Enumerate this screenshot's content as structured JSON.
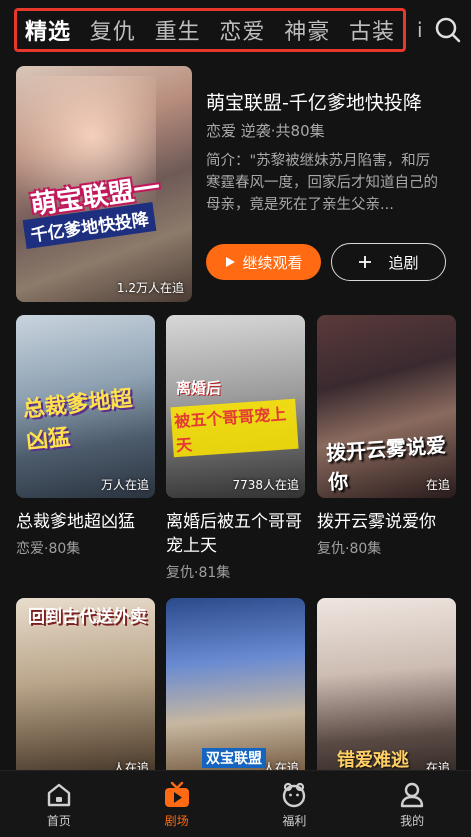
{
  "tabs": [
    {
      "label": "精选",
      "active": true
    },
    {
      "label": "复仇"
    },
    {
      "label": "重生"
    },
    {
      "label": "恋爱"
    },
    {
      "label": "神豪"
    },
    {
      "label": "古装"
    }
  ],
  "more_tab": "i",
  "featured": {
    "poster_title_a": "萌宝联盟一",
    "poster_title_b": "千亿爹地快投降",
    "watch_count": "1.2万人在追",
    "title": "萌宝联盟-千亿爹地快投降",
    "meta": "恋爱 逆袭·共80集",
    "description": "简介：\"苏黎被继妹苏月陷害，和厉寒霆春风一度，回家后才知道自己的母亲，竟是死在了亲生父亲...",
    "continue_label": "继续观看",
    "follow_label": "追剧"
  },
  "cards": [
    {
      "title": "总裁爹地超凶猛",
      "meta": "恋爱·80集",
      "count": "万人在追",
      "poster_text": "总裁爹地超凶猛"
    },
    {
      "title": "离婚后被五个哥哥宠上天",
      "meta": "复仇·81集",
      "count": "7738人在追",
      "poster_text_a": "离婚后",
      "poster_text_b": "被五个哥哥宠上天"
    },
    {
      "title": "拨开云雾说爱你",
      "meta": "复仇·80集",
      "count": "在追",
      "poster_text": "拨开云雾说爱你"
    },
    {
      "title": "",
      "meta": "",
      "count": "人在追",
      "poster_text": "回到古代送外卖"
    },
    {
      "title": "",
      "meta": "",
      "count": "人在追",
      "poster_text": "双宝联盟"
    },
    {
      "title": "",
      "meta": "",
      "count": "在追",
      "poster_text": "错爱难逃"
    }
  ],
  "nav": [
    {
      "label": "首页",
      "icon": "home-icon"
    },
    {
      "label": "剧场",
      "icon": "theater-icon",
      "active": true
    },
    {
      "label": "福利",
      "icon": "gift-icon"
    },
    {
      "label": "我的",
      "icon": "profile-icon"
    }
  ],
  "colors": {
    "accent": "#ff6a13",
    "tab_border": "#e8372b",
    "background": "#131313"
  }
}
